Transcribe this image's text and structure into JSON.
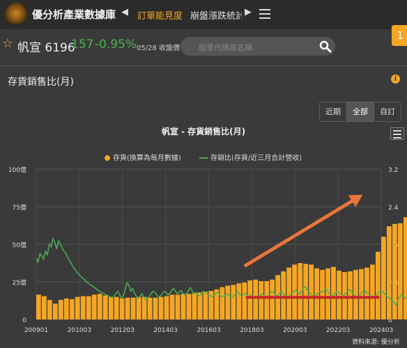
{
  "header": {
    "site_title": "優分析產業數據庫",
    "nav_active": "訂單能見度",
    "nav_next": "崩盤漲跌統計"
  },
  "stock": {
    "name": "帆宣 6196",
    "price": "157",
    "change": "-0.95%",
    "date": "05/28 收盤價"
  },
  "search": {
    "placeholder": "股票代碼或名稱"
  },
  "badge": {
    "text": "1"
  },
  "panel": {
    "title": "存貨銷售比(月)",
    "info": "i"
  },
  "range_buttons": {
    "recent": "近期",
    "all": "全部",
    "custom": "自訂"
  },
  "source_text": "資料來源: 優分析",
  "colors": {
    "bar": "#f5a623",
    "line": "#4caf50",
    "annotation_arrow": "#e8763a",
    "annotation_line": "#c62828"
  },
  "chart_data": {
    "type": "bar",
    "title": "帆宣 - 存貨銷售比(月)",
    "left_axis": {
      "ticks": [
        "0",
        "25億",
        "50億",
        "75億",
        "100億"
      ],
      "ylim": [
        0,
        100
      ]
    },
    "right_axis": {
      "ticks": [
        "0",
        "0.8",
        "1.6",
        "2.4",
        "3.2"
      ],
      "ylim": [
        0,
        3.2
      ]
    },
    "x_ticks": [
      "200901",
      "201003",
      "201203",
      "201403",
      "201603",
      "201803",
      "202003",
      "202203",
      "202403"
    ],
    "legend": [
      {
        "name": "存貨(換算為每月數據)",
        "symbol": "dot"
      },
      {
        "name": "存銷比(存貨/近三月合計營收)",
        "symbol": "line"
      }
    ],
    "series": [
      {
        "name": "存貨(換算為每月數據)",
        "type": "bar",
        "x_start": "2009-01",
        "interval_months": 3,
        "values": [
          16.5,
          15.5,
          13.0,
          10.5,
          13.0,
          14.0,
          13.5,
          15.0,
          15.5,
          15.5,
          16.5,
          17.0,
          16.0,
          15.0,
          15.0,
          14.0,
          14.5,
          14.5,
          15.0,
          15.0,
          14.5,
          14.5,
          15.0,
          15.5,
          16.5,
          16.5,
          17.0,
          17.0,
          17.5,
          18.0,
          18.5,
          19.0,
          20.0,
          21.5,
          22.5,
          23.0,
          24.0,
          24.5,
          26.0,
          26.5,
          25.5,
          25.5,
          26.5,
          29.5,
          32.0,
          34.5,
          36.5,
          37.5,
          37.0,
          36.5,
          34.0,
          33.0,
          34.0,
          35.0,
          32.5,
          31.5,
          32.0,
          33.0,
          33.5,
          34.5,
          36.5,
          45.0,
          55.0,
          62.0,
          63.5,
          64.0,
          68.0,
          73.0,
          77.0,
          73.5,
          76.5
        ]
      },
      {
        "name": "存銷比(存貨/近三月合計營收)",
        "type": "line",
        "axis": "right",
        "x_start": "2009-01",
        "interval_months": 1,
        "values": [
          1.3,
          1.22,
          1.4,
          1.35,
          1.28,
          1.45,
          1.38,
          1.6,
          1.55,
          1.72,
          1.65,
          1.5,
          1.68,
          1.6,
          1.52,
          1.45,
          1.4,
          1.32,
          1.25,
          1.18,
          1.12,
          1.06,
          1.0,
          0.96,
          0.92,
          0.88,
          0.85,
          0.8,
          0.78,
          0.74,
          0.72,
          0.69,
          0.66,
          0.63,
          0.6,
          0.58,
          0.56,
          0.54,
          0.52,
          0.5,
          0.48,
          0.46,
          0.5,
          0.55,
          0.6,
          0.52,
          0.45,
          0.5,
          0.65,
          0.78,
          0.72,
          0.6,
          0.66,
          0.55,
          0.5,
          0.45,
          0.5,
          0.55,
          0.48,
          0.42,
          0.45,
          0.5,
          0.55,
          0.6,
          0.58,
          0.52,
          0.48,
          0.5,
          0.55,
          0.6,
          0.58,
          0.52,
          0.55,
          0.62,
          0.66,
          0.6,
          0.55,
          0.58,
          0.62,
          0.56,
          0.52,
          0.55,
          0.6,
          0.68,
          0.62,
          0.55,
          0.58,
          0.52,
          0.5,
          0.55,
          0.6,
          0.58,
          0.55,
          0.52,
          0.5,
          0.48,
          0.52,
          0.55,
          0.58,
          0.52,
          0.48,
          0.5,
          0.52,
          0.55,
          0.5,
          0.46,
          0.48,
          0.52,
          0.55,
          0.58,
          0.52,
          0.5,
          0.54,
          0.56,
          0.5,
          0.48,
          0.52,
          0.5,
          0.46,
          0.48,
          0.5,
          0.52,
          0.55,
          0.5,
          0.48,
          0.5,
          0.55,
          0.6,
          0.58,
          0.52,
          0.5,
          0.55,
          0.6,
          0.56,
          0.52,
          0.5,
          0.48,
          0.52,
          0.56,
          0.6,
          0.62,
          0.58,
          0.54,
          0.6,
          0.66,
          0.7,
          0.64,
          0.58,
          0.55,
          0.5,
          0.48,
          0.52,
          0.56,
          0.6,
          0.58,
          0.62,
          0.66,
          0.6,
          0.55,
          0.52,
          0.5,
          0.55,
          0.6,
          0.58,
          0.55,
          0.5,
          0.52,
          0.56,
          0.6,
          0.64,
          0.6,
          0.55,
          0.5,
          0.48,
          0.5,
          0.55,
          0.6,
          0.62,
          0.58,
          0.55,
          0.52,
          0.48,
          0.45,
          0.5,
          0.55,
          0.6,
          0.62,
          0.58,
          0.54,
          0.5,
          0.47,
          0.44,
          0.4,
          0.36,
          0.3,
          0.42,
          0.48,
          0.52,
          0.5,
          0.46,
          0.44,
          0.48,
          0.5,
          0.46,
          0.5,
          0.54,
          0.58,
          0.56,
          0.52,
          0.55,
          0.6,
          0.58,
          0.55,
          0.52,
          0.56,
          0.6,
          0.58,
          0.54
        ]
      }
    ],
    "annotations": [
      {
        "type": "arrow",
        "color": "#e8763a",
        "from": [
          "2018-06",
          36
        ],
        "to": [
          "2023-09",
          83
        ]
      },
      {
        "type": "hline",
        "color": "#c62828",
        "axis": "right",
        "value": 0.47,
        "x_range": [
          "2018-06",
          "2024-06"
        ]
      }
    ]
  }
}
